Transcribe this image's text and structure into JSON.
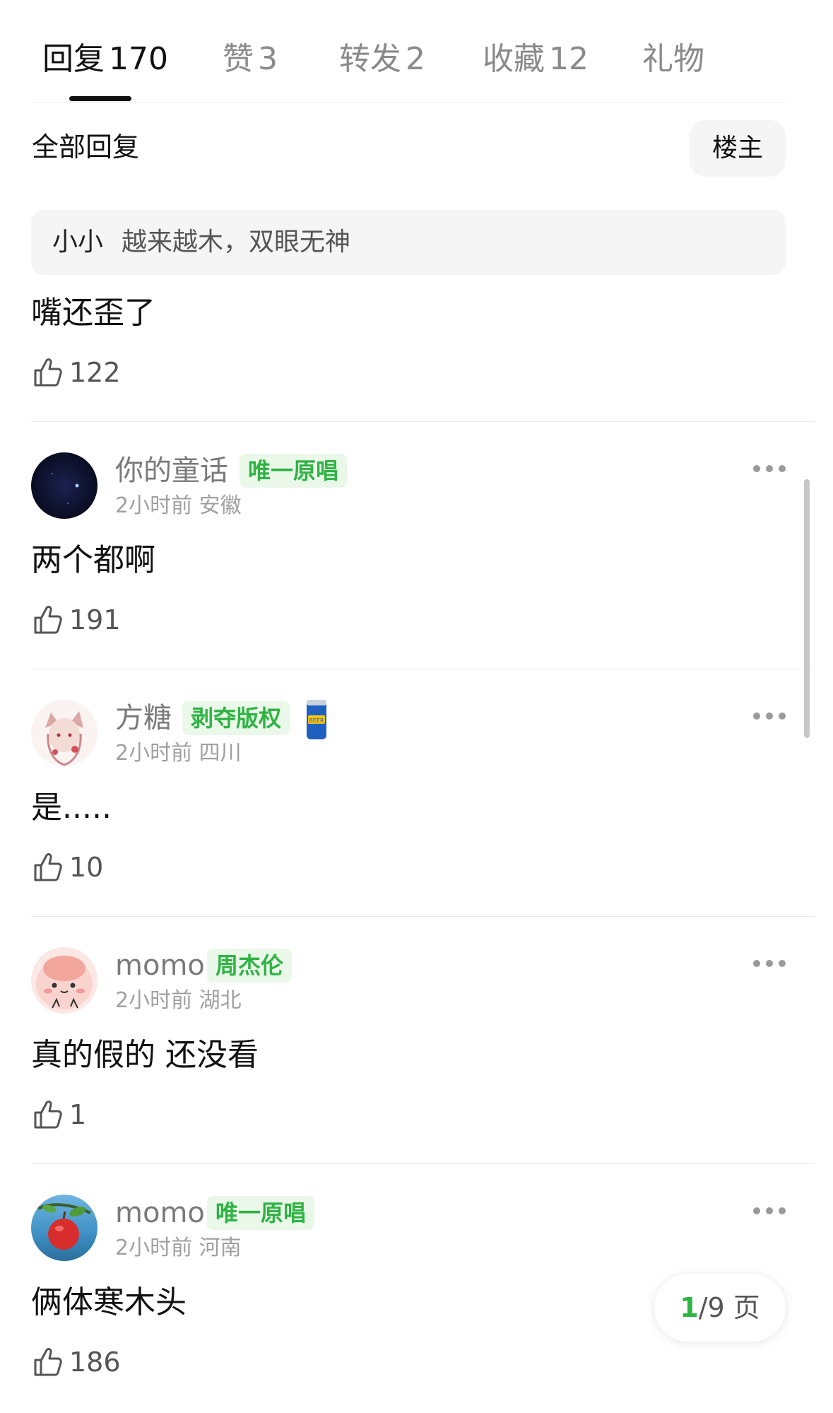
{
  "tabs": [
    {
      "label": "回复",
      "count": "170",
      "active": true
    },
    {
      "label": "赞",
      "count": "3",
      "active": false
    },
    {
      "label": "转发",
      "count": "2",
      "active": false
    },
    {
      "label": "收藏",
      "count": "12",
      "active": false
    },
    {
      "label": "礼物",
      "count": "",
      "active": false
    }
  ],
  "section": {
    "title": "全部回复",
    "owner_button": "楼主"
  },
  "reply": {
    "quote_author": "小小",
    "quote_text": "越来越木，双眼无神",
    "text": "嘴还歪了",
    "likes": "122"
  },
  "comments": [
    {
      "username": "你的童话",
      "badge": "唯一原唱",
      "time": "2小时前",
      "location": "安徽",
      "text": "两个都啊",
      "likes": "191",
      "avatar_icon": "night-sky-avatar"
    },
    {
      "username": "方糖",
      "badge": "剥夺版权",
      "time": "2小时前",
      "location": "四川",
      "text": "是.....",
      "likes": "10",
      "avatar_icon": "anime-girl-avatar",
      "extra_icon": "beer-can-icon"
    },
    {
      "username": "momo",
      "badge": "周杰伦",
      "time": "2小时前",
      "location": "湖北",
      "text": "真的假的 还没看",
      "likes": "1",
      "avatar_icon": "peach-avatar"
    },
    {
      "username": "momo",
      "badge": "唯一原唱",
      "time": "2小时前",
      "location": "河南",
      "text": "俩体寒木头",
      "likes": "186",
      "avatar_icon": "apple-avatar"
    }
  ],
  "pagination": {
    "current": "1",
    "total": "/9 页"
  },
  "colors": {
    "accent_green": "#2fb344",
    "badge_bg": "#eaf8e9",
    "muted_text": "#8a8a8a"
  }
}
